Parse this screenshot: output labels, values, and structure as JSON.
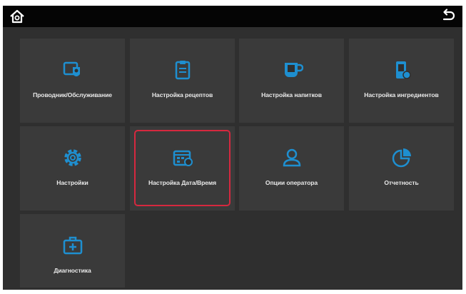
{
  "topbar": {
    "home_icon": "home-icon",
    "back_icon": "back-arrow-icon"
  },
  "colors": {
    "accent": "#1e8fd0",
    "selection": "#d6283f",
    "tile_bg": "#3a3a3a",
    "screen_bg": "#2f2f2f"
  },
  "tiles": [
    {
      "label": "Проводник/Обслуживание",
      "icon": "gear-shield-icon"
    },
    {
      "label": "Настройка рецептов",
      "icon": "clipboard-icon"
    },
    {
      "label": "Настройка напитков",
      "icon": "cup-icon"
    },
    {
      "label": "Настройка ингредиентов",
      "icon": "canister-icon"
    },
    {
      "label": "Настройки",
      "icon": "gear-icon"
    },
    {
      "label": "Настройка Дата/Время",
      "icon": "calendar-clock-icon",
      "selected": true
    },
    {
      "label": "Опции оператора",
      "icon": "user-icon"
    },
    {
      "label": "Отчетность",
      "icon": "pie-chart-icon"
    },
    {
      "label": "Диагностика",
      "icon": "medkit-icon"
    }
  ]
}
